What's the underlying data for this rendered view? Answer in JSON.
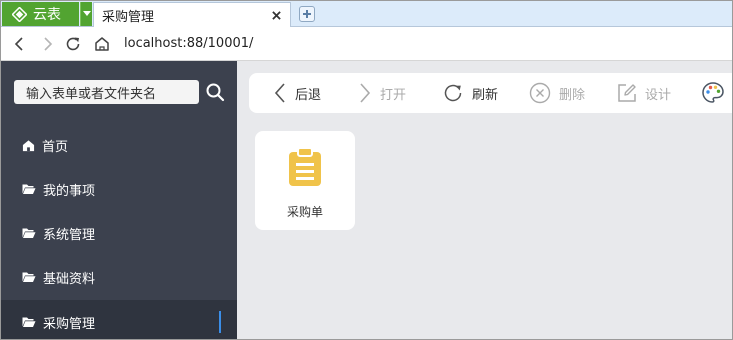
{
  "tabbar": {
    "brand_label": "云表",
    "active_tab": {
      "title": "采购管理"
    },
    "icons": {
      "brand": "diamond-logo-icon",
      "dropdown": "caret-down-icon",
      "close": "close-icon",
      "new_tab": "new-tab-icon"
    }
  },
  "addressbar": {
    "url": "localhost:88/10001/",
    "icons": [
      "back-icon",
      "forward-icon",
      "refresh-icon",
      "home-icon"
    ]
  },
  "sidebar": {
    "search": {
      "placeholder": "输入表单或者文件夹名",
      "icon": "search-icon"
    },
    "items": [
      {
        "label": "首页",
        "icon": "home-icon",
        "active": false
      },
      {
        "label": "我的事项",
        "icon": "folder-open-icon",
        "active": false
      },
      {
        "label": "系统管理",
        "icon": "folder-open-icon",
        "active": false
      },
      {
        "label": "基础资料",
        "icon": "folder-open-icon",
        "active": false
      },
      {
        "label": "采购管理",
        "icon": "folder-open-icon",
        "active": true
      }
    ]
  },
  "toolbar": {
    "items": [
      {
        "label": "后退",
        "icon": "chevron-left-icon",
        "enabled": true
      },
      {
        "label": "打开",
        "icon": "chevron-right-icon",
        "enabled": false
      },
      {
        "label": "刷新",
        "icon": "refresh-icon",
        "enabled": true
      },
      {
        "label": "删除",
        "icon": "close-circle-icon",
        "enabled": false
      },
      {
        "label": "设计",
        "icon": "edit-icon",
        "enabled": false
      },
      {
        "label": "",
        "icon": "palette-icon",
        "enabled": true
      }
    ]
  },
  "content": {
    "cards": [
      {
        "label": "采购单",
        "icon": "clipboard-icon"
      }
    ]
  },
  "colors": {
    "brand_green": "#52a431",
    "sidebar_bg": "#3c414e",
    "sidebar_active_bg": "#2f343f",
    "accent_blue": "#3b8ee8",
    "card_icon_yellow": "#f0c34a",
    "disabled_text": "#aaaaaa"
  }
}
